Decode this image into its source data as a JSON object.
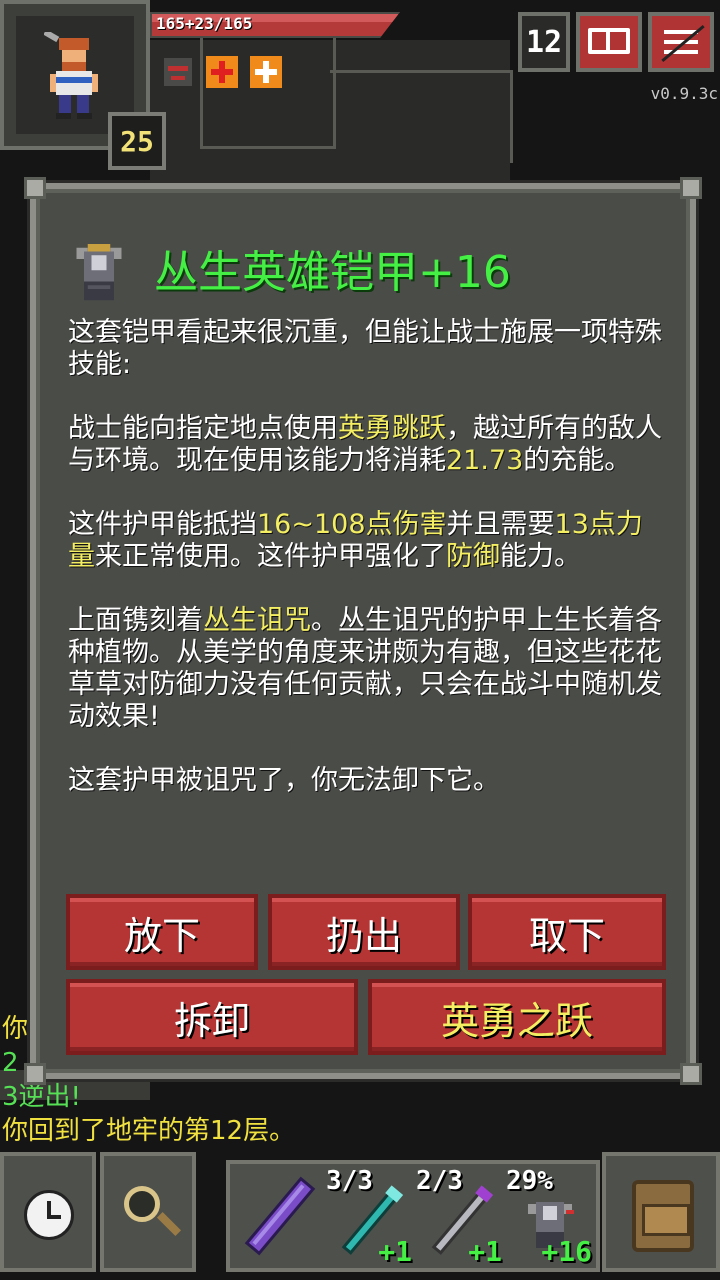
{
  "status": {
    "hp_text": "165+23/165",
    "hp_fraction": 1.0,
    "level": "25",
    "depth": "12",
    "version": "v0.9.3c"
  },
  "item_window": {
    "title": "丛生英雄铠甲+16",
    "description": [
      [
        {
          "t": "这套铠甲看起来很沉重，但能让战士施展一项特殊技能:",
          "hl": false
        }
      ],
      [
        {
          "t": "战士能向指定地点使用",
          "hl": false
        },
        {
          "t": "英勇跳跃",
          "hl": true
        },
        {
          "t": "，越过所有的敌人与环境。现在使用该能力将消耗",
          "hl": false
        },
        {
          "t": "21.73",
          "hl": true
        },
        {
          "t": "的充能。",
          "hl": false
        }
      ],
      [
        {
          "t": "这件护甲能抵挡",
          "hl": false
        },
        {
          "t": "16~108点伤害",
          "hl": true
        },
        {
          "t": "并且需要",
          "hl": false
        },
        {
          "t": "13点力量",
          "hl": true
        },
        {
          "t": "来正常使用。这件护甲强化了",
          "hl": false
        },
        {
          "t": "防御",
          "hl": true
        },
        {
          "t": "能力。",
          "hl": false
        }
      ],
      [
        {
          "t": "上面镌刻着",
          "hl": false
        },
        {
          "t": "丛生诅咒",
          "hl": true
        },
        {
          "t": "。丛生诅咒的护甲上生长着各种植物。从美学的角度来讲颇为有趣，但这些花花草草对防御力没有任何贡献，只会在战斗中随机发动效果!",
          "hl": false
        }
      ],
      [
        {
          "t": "这套护甲被诅咒了，你无法卸下它。",
          "hl": false
        }
      ]
    ],
    "buttons": {
      "drop": "放下",
      "throw": "扔出",
      "unequip": "取下",
      "disassemble": "拆卸",
      "heroic_leap": "英勇之跃"
    }
  },
  "log": {
    "partial_1": "你",
    "partial_2": "2",
    "partial_3": "3逆出!",
    "last": "你回到了地牢的第12层。"
  },
  "quickslots": [
    {
      "icon": "wand-icon",
      "count": "",
      "upgrade": ""
    },
    {
      "icon": "wand-icon",
      "count": "3/3",
      "upgrade": "+1"
    },
    {
      "icon": "wand-icon",
      "count": "2/3",
      "upgrade": "+1"
    },
    {
      "icon": "armor-icon",
      "count": "29%",
      "upgrade": "+16"
    }
  ],
  "colors": {
    "title_green": "#44f044",
    "highlight_yellow": "#f3ee62",
    "button_red": "#b53434"
  }
}
